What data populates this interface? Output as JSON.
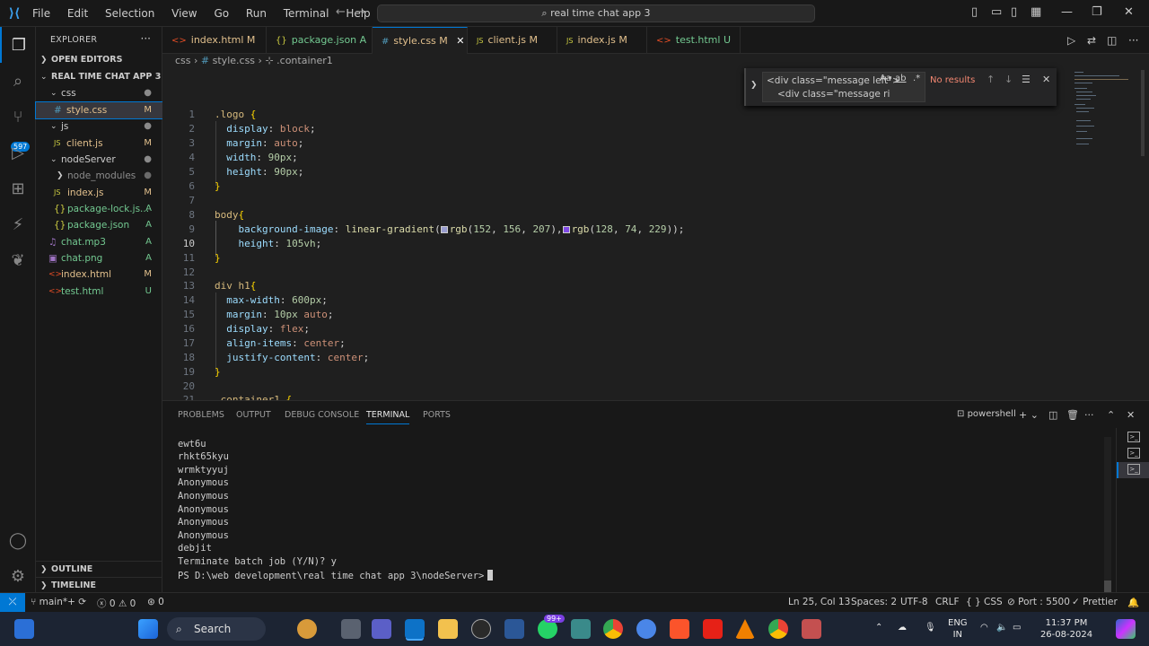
{
  "titlebar": {
    "menu": [
      "File",
      "Edit",
      "Selection",
      "View",
      "Go",
      "Run",
      "Terminal",
      "Help"
    ],
    "command_center": "real time chat app 3"
  },
  "activity": {
    "source_control_badge": "597"
  },
  "explorer": {
    "title": "EXPLORER",
    "open_editors": "OPEN EDITORS",
    "root": "REAL TIME CHAT APP 3",
    "items": [
      {
        "name": "css",
        "status": "",
        "type": "folder"
      },
      {
        "name": "style.css",
        "status": "M",
        "type": "css"
      },
      {
        "name": "js",
        "status": "",
        "type": "folder"
      },
      {
        "name": "client.js",
        "status": "M",
        "type": "js"
      },
      {
        "name": "nodeServer",
        "status": "",
        "type": "folder"
      },
      {
        "name": "node_modules",
        "status": "",
        "type": "folder"
      },
      {
        "name": "index.js",
        "status": "M",
        "type": "js"
      },
      {
        "name": "package-lock.js...",
        "status": "A",
        "type": "json"
      },
      {
        "name": "package.json",
        "status": "A",
        "type": "json"
      },
      {
        "name": "chat.mp3",
        "status": "A",
        "type": "mp3"
      },
      {
        "name": "chat.png",
        "status": "A",
        "type": "png"
      },
      {
        "name": "index.html",
        "status": "M",
        "type": "html"
      },
      {
        "name": "test.html",
        "status": "U",
        "type": "html"
      }
    ],
    "outline": "OUTLINE",
    "timeline": "TIMELINE"
  },
  "tabs": [
    {
      "name": "index.html",
      "status": "M",
      "icon": "<>",
      "color": "#e44d26"
    },
    {
      "name": "package.json",
      "status": "A",
      "icon": "{}",
      "color": "#cbcb41"
    },
    {
      "name": "style.css",
      "status": "M",
      "icon": "#",
      "color": "#519aba",
      "active": true
    },
    {
      "name": "client.js",
      "status": "M",
      "icon": "JS",
      "color": "#cbcb41"
    },
    {
      "name": "index.js",
      "status": "M",
      "icon": "JS",
      "color": "#cbcb41"
    },
    {
      "name": "test.html",
      "status": "U",
      "icon": "<>",
      "color": "#e44d26"
    }
  ],
  "breadcrumb": [
    "css",
    "style.css",
    ".container1"
  ],
  "find": {
    "line1": "<div class=\"message left\">",
    "line2": "<div class=\"message ri",
    "result": "No results",
    "opt_case": "Aa",
    "opt_word": "ab",
    "opt_regex": ".*"
  },
  "code_lines": [
    [
      "1",
      ".logo {"
    ],
    [
      "2",
      "display: block;"
    ],
    [
      "3",
      "margin: auto;"
    ],
    [
      "4",
      "width: 90px;"
    ],
    [
      "5",
      "height: 90px;"
    ],
    [
      "6",
      "}"
    ],
    [
      "7",
      ""
    ],
    [
      "8",
      "body{"
    ],
    [
      "9",
      "background-image: linear-gradient(rgb(152, 156, 207),rgb(128, 74, 229));"
    ],
    [
      "10",
      "height: 105vh;"
    ],
    [
      "11",
      "}"
    ],
    [
      "12",
      ""
    ],
    [
      "13",
      "div h1{"
    ],
    [
      "14",
      "max-width: 600px;"
    ],
    [
      "15",
      "margin: 10px auto;"
    ],
    [
      "16",
      "display: flex;"
    ],
    [
      "17",
      "align-items: center;"
    ],
    [
      "18",
      "justify-content: center;"
    ],
    [
      "19",
      "}"
    ],
    [
      "20",
      ""
    ],
    [
      "21",
      ".container1 {"
    ]
  ],
  "panel": {
    "tabs": [
      "PROBLEMS",
      "OUTPUT",
      "DEBUG CONSOLE",
      "TERMINAL",
      "PORTS"
    ],
    "shell": "powershell",
    "terminal_lines": [
      "ewt6u",
      "rhkt65kyu",
      "wrmktyyuj",
      "Anonymous",
      "Anonymous",
      "Anonymous",
      "Anonymous",
      "Anonymous",
      "debjit",
      "Terminate batch job (Y/N)? y",
      "PS D:\\web development\\real time chat app 3\\nodeServer>"
    ]
  },
  "status": {
    "branch": "main*+",
    "errors": "0",
    "warnings": "0",
    "ports": "0",
    "position": "Ln 25, Col 13",
    "spaces": "Spaces: 2",
    "encoding": "UTF-8",
    "eol": "CRLF",
    "language": "CSS",
    "port": "Port : 5500",
    "prettier": "Prettier"
  },
  "taskbar": {
    "search": "Search",
    "whatsapp_badge": "99+",
    "lang1": "ENG",
    "lang2": "IN",
    "time": "11:37 PM",
    "date": "26-08-2024"
  },
  "colors": {
    "accent": "#0078d4",
    "swatch1": "#989ccf",
    "swatch2": "#804ae5"
  }
}
